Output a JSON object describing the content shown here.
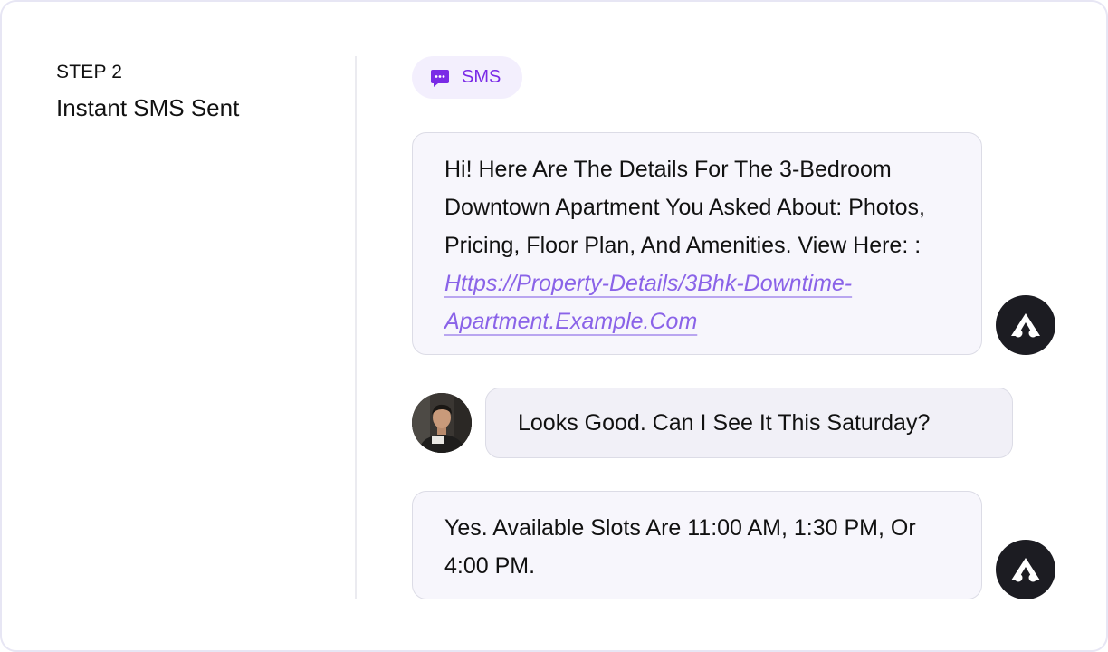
{
  "step": {
    "label": "STEP 2",
    "title": "Instant SMS Sent"
  },
  "channel": {
    "label": "SMS",
    "icon": "chat-bubble-icon",
    "color": "#7a2ae6",
    "background": "#f3effd"
  },
  "messages": [
    {
      "sender": "agent",
      "text": "Hi! Here Are The Details For The 3-Bedroom Downtown Apartment You Asked About: Photos, Pricing, Floor Plan, And Amenities. View Here: : ",
      "link": "Https://Property-Details/3Bhk-Downtime-Apartment.Example.Com",
      "avatar_icon": "brand-logo-icon"
    },
    {
      "sender": "user",
      "text": "Looks Good. Can I See It This Saturday?",
      "avatar_icon": "user-photo"
    },
    {
      "sender": "agent",
      "text": "Yes. Available Slots Are 11:00 AM, 1:30 PM, Or 4:00 PM.",
      "avatar_icon": "brand-logo-icon"
    }
  ],
  "colors": {
    "link": "#8a63e8",
    "agent_bubble": "#f7f6fc",
    "user_bubble": "#f1f0f7",
    "bot_avatar": "#1c1c22"
  }
}
